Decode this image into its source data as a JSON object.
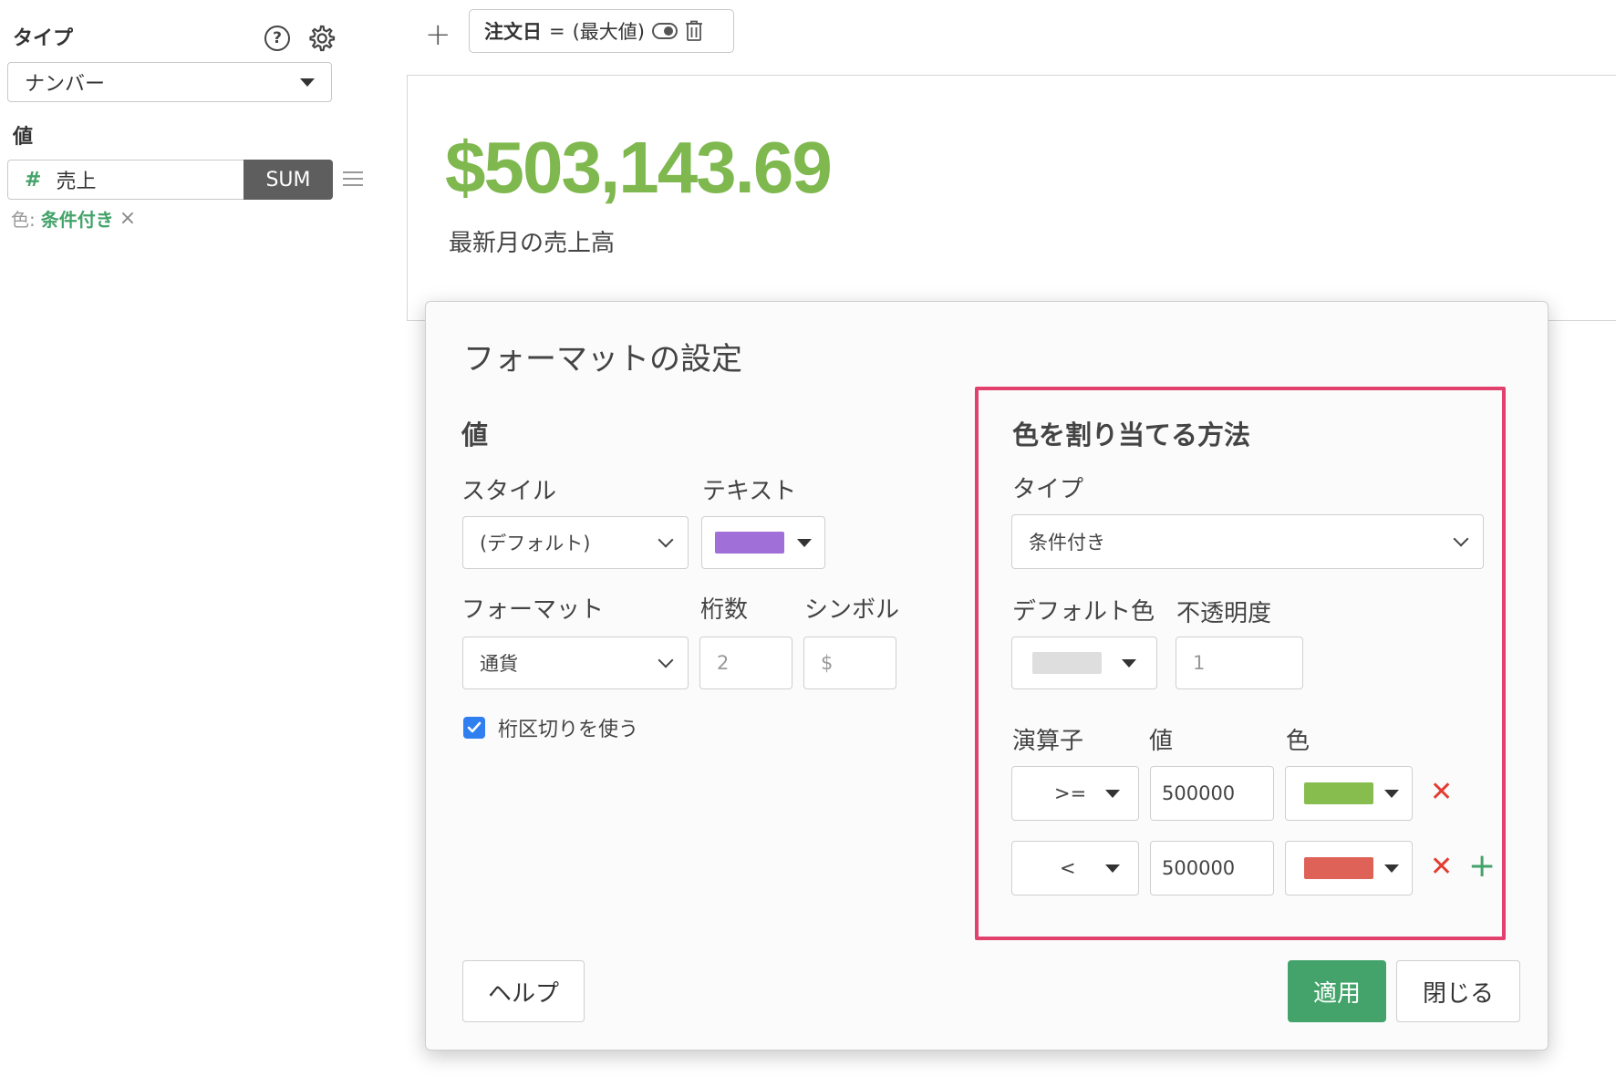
{
  "sidebar": {
    "type_label": "タイプ",
    "type_value": "ナンバー",
    "value_label": "値",
    "field_icon": "#",
    "field_name": "売上",
    "aggregate": "SUM",
    "color_label": "色:",
    "color_value": "条件付き",
    "remove_glyph": "×",
    "help_glyph": "?"
  },
  "filter_bar": {
    "add_glyph": "+",
    "filter_name": "注文日",
    "filter_op": "=",
    "filter_value": "(最大値)"
  },
  "number_card": {
    "value": "$503,143.69",
    "caption": "最新月の売上高",
    "value_color": "#7fb84e"
  },
  "dialog": {
    "title": "フォーマットの設定",
    "value_section": {
      "heading": "値",
      "style_label": "スタイル",
      "style_value": "(デフォルト)",
      "text_label": "テキスト",
      "text_color": "#a16fd8",
      "format_label": "フォーマット",
      "format_value": "通貨",
      "digits_label": "桁数",
      "digits_placeholder": "2",
      "symbol_label": "シンボル",
      "symbol_placeholder": "$",
      "separator_label": "桁区切りを使う",
      "separator_checked": true
    },
    "color_section": {
      "heading": "色を割り当てる方法",
      "type_label": "タイプ",
      "type_value": "条件付き",
      "default_color_label": "デフォルト色",
      "default_color": "#dedede",
      "opacity_label": "不透明度",
      "opacity_placeholder": "1",
      "operator_label": "演算子",
      "value_label": "値",
      "color_label": "色",
      "rules": [
        {
          "operator": ">=",
          "value": "500000",
          "color": "#86bd4e"
        },
        {
          "operator": "<",
          "value": "500000",
          "color": "#df6258"
        }
      ],
      "remove_glyph": "✕",
      "add_glyph": "+"
    },
    "help_button": "ヘルプ",
    "apply_button": "適用",
    "close_button": "閉じる"
  },
  "colors": {
    "accent_green": "#43a36a",
    "highlight_pink": "#e2416e",
    "delete_red": "#e23b30"
  }
}
